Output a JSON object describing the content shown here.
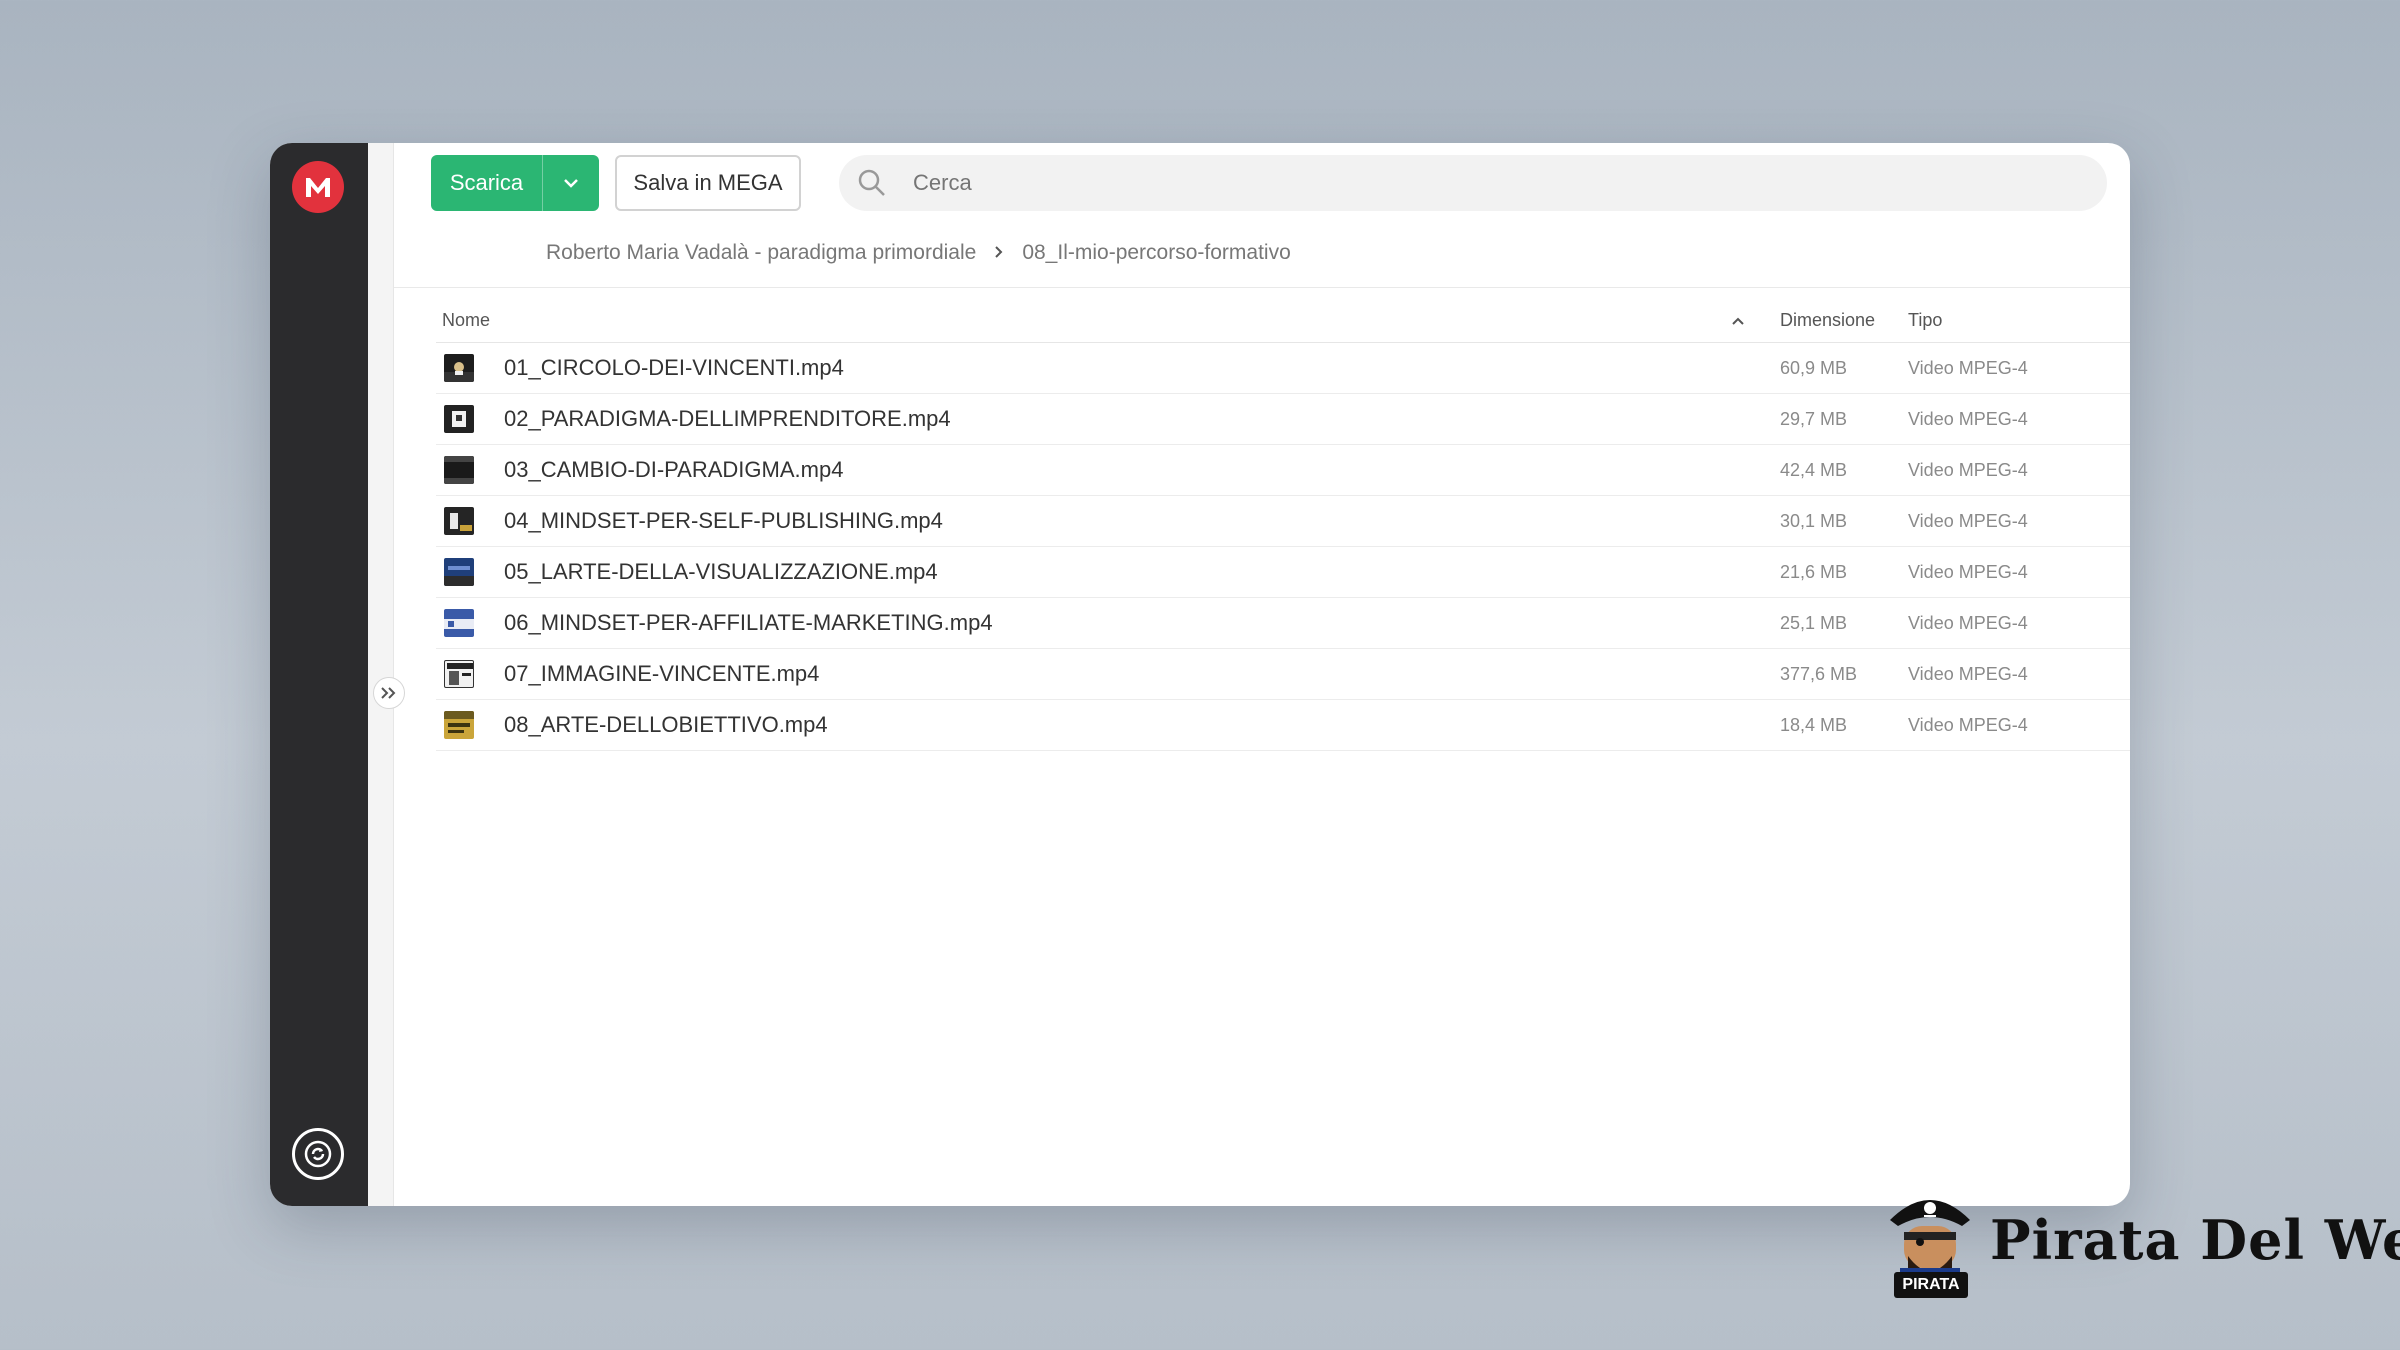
{
  "toolbar": {
    "download_label": "Scarica",
    "save_label": "Salva in MEGA",
    "search_placeholder": "Cerca"
  },
  "breadcrumb": {
    "items": [
      "Roberto Maria Vadalà - paradigma primordiale",
      "08_Il-mio-percorso-formativo"
    ]
  },
  "table": {
    "headers": {
      "name": "Nome",
      "size": "Dimensione",
      "type": "Tipo"
    },
    "sort_indicator": "chevron-up-icon",
    "rows": [
      {
        "name": "01_CIRCOLO-DEI-VINCENTI.mp4",
        "size": "60,9 MB",
        "type": "Video MPEG-4"
      },
      {
        "name": "02_PARADIGMA-DELLIMPRENDITORE.mp4",
        "size": "29,7 MB",
        "type": "Video MPEG-4"
      },
      {
        "name": "03_CAMBIO-DI-PARADIGMA.mp4",
        "size": "42,4 MB",
        "type": "Video MPEG-4"
      },
      {
        "name": "04_MINDSET-PER-SELF-PUBLISHING.mp4",
        "size": "30,1 MB",
        "type": "Video MPEG-4"
      },
      {
        "name": "05_LARTE-DELLA-VISUALIZZAZIONE.mp4",
        "size": "21,6 MB",
        "type": "Video MPEG-4"
      },
      {
        "name": "06_MINDSET-PER-AFFILIATE-MARKETING.mp4",
        "size": "25,1 MB",
        "type": "Video MPEG-4"
      },
      {
        "name": "07_IMMAGINE-VINCENTE.mp4",
        "size": "377,6 MB",
        "type": "Video MPEG-4"
      },
      {
        "name": "08_ARTE-DELLOBIETTIVO.mp4",
        "size": "18,4 MB",
        "type": "Video MPEG-4"
      }
    ]
  },
  "branding": {
    "name": "Pirata Del Web",
    "mascot_tag": "PIRATA"
  },
  "colors": {
    "download_button": "#2bb673",
    "mega_red": "#e2323d",
    "sidebar": "#2b2b2d"
  }
}
